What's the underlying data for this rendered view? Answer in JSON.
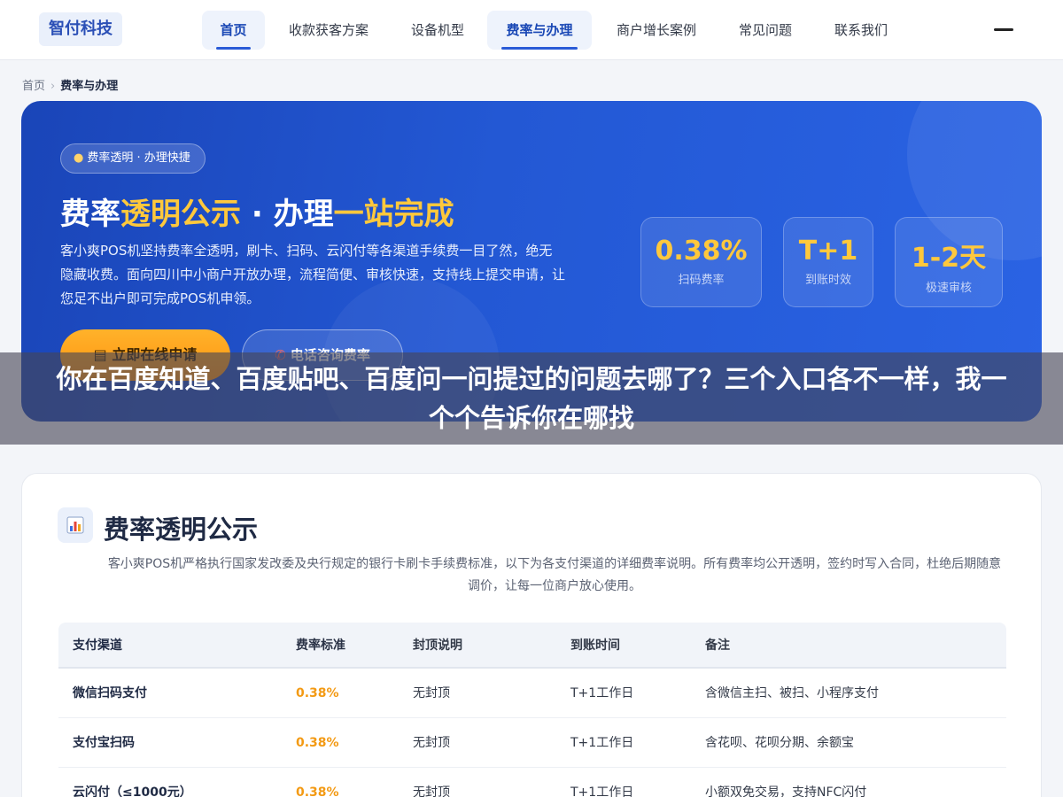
{
  "nav": {
    "logo": "智付科技",
    "items": [
      "首页",
      "收款获客方案",
      "设备机型",
      "费率与办理",
      "商户增长案例",
      "常见问题",
      "联系我们"
    ]
  },
  "breadcrumb": {
    "home": "首页",
    "current": "费率与办理"
  },
  "hero": {
    "badge": "费率透明 · 办理快捷",
    "title_parts": [
      "费率",
      "透明公示",
      " · 办理",
      "一站完成"
    ],
    "description": "客小爽POS机坚持费率全透明，刷卡、扫码、云闪付等各渠道手续费一目了然，绝无隐藏收费。面向四川中小商户开放办理，流程简便、审核快速，支持线上提交申请，让您足不出户即可完成POS机申领。",
    "primary_button": "立即在线申请",
    "secondary_button": "电话咨询费率",
    "stats": [
      {
        "value": "0.38%",
        "label": "扫码费率"
      },
      {
        "value": "T+1",
        "label": "到账时效"
      },
      {
        "value": "1-2天",
        "label": "极速审核"
      }
    ]
  },
  "overlay": {
    "text": "你在百度知道、百度贴吧、百度问一问提过的问题去哪了？三个入口各不一样，我一个个告诉你在哪找"
  },
  "section": {
    "title": "费率透明公示",
    "description": "客小爽POS机严格执行国家发改委及央行规定的银行卡刷卡手续费标准，以下为各支付渠道的详细费率说明。所有费率均公开透明，签约时写入合同，杜绝后期随意调价，让每一位商户放心使用。",
    "table": {
      "headers": [
        "支付渠道",
        "费率标准",
        "封顶说明",
        "到账时间",
        "备注"
      ],
      "rows": [
        [
          "微信扫码支付",
          "0.38%",
          "无封顶",
          "T+1工作日",
          "含微信主扫、被扫、小程序支付"
        ],
        [
          "支付宝扫码",
          "0.38%",
          "无封顶",
          "T+1工作日",
          "含花呗、花呗分期、余额宝"
        ],
        [
          "云闪付（≤1000元）",
          "0.38%",
          "无封顶",
          "T+1工作日",
          "小额双免交易，支持NFC闪付"
        ]
      ]
    }
  },
  "colors": {
    "primary": "#2358d4",
    "accent": "#ffc83c",
    "orange": "#ff9f1a"
  }
}
